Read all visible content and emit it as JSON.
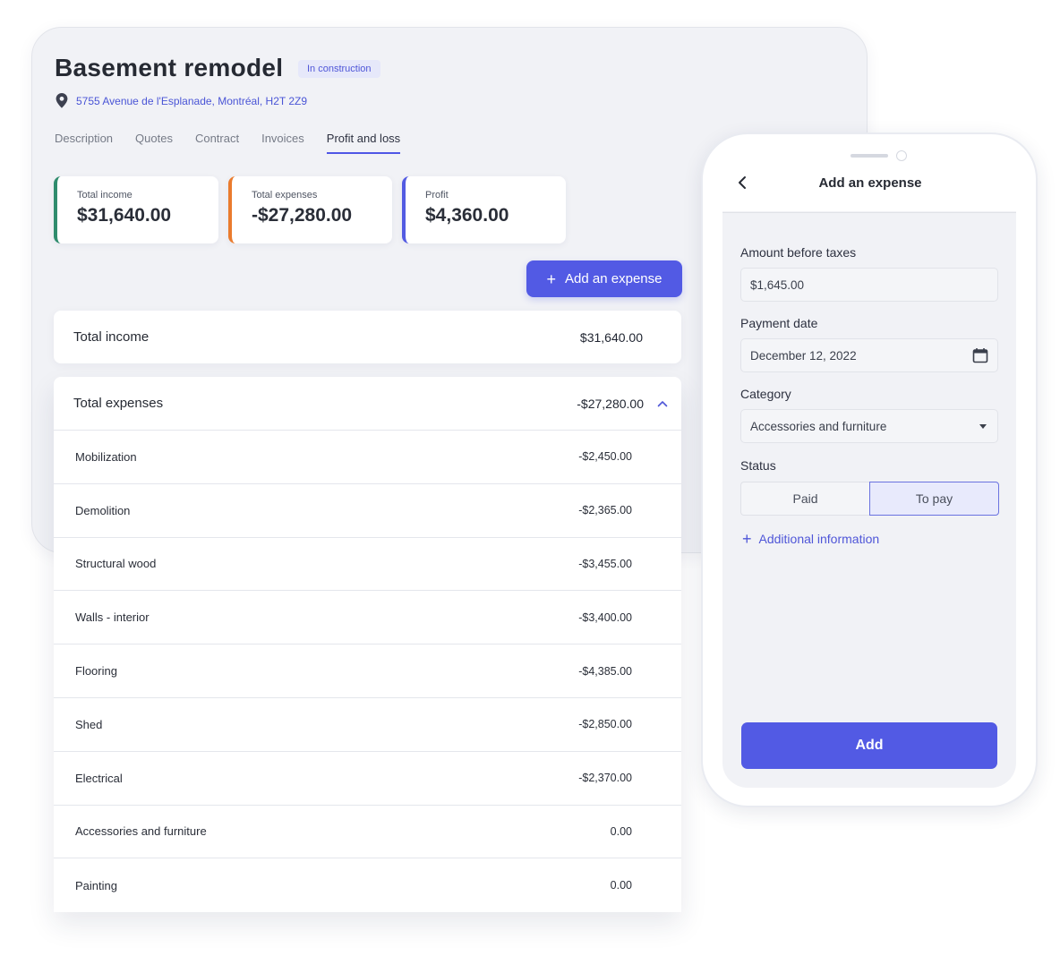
{
  "project": {
    "title": "Basement remodel",
    "status": "In construction",
    "address": "5755 Avenue de l'Esplanade, Montréal, H2T 2Z9"
  },
  "tabs": [
    "Description",
    "Quotes",
    "Contract",
    "Invoices",
    "Profit and loss"
  ],
  "summary": {
    "income_label": "Total income",
    "income_value": "$31,640.00",
    "expenses_label": "Total expenses",
    "expenses_value": "-$27,280.00",
    "profit_label": "Profit",
    "profit_value": "$4,360.00"
  },
  "add_expense_label": "Add an expense",
  "income_panel": {
    "label": "Total income",
    "value": "$31,640.00"
  },
  "expenses_panel": {
    "label": "Total expenses",
    "value": "-$27,280.00",
    "rows": [
      {
        "name": "Mobilization",
        "amount": "-$2,450.00"
      },
      {
        "name": "Demolition",
        "amount": "-$2,365.00"
      },
      {
        "name": "Structural wood",
        "amount": "-$3,455.00"
      },
      {
        "name": "Walls - interior",
        "amount": "-$3,400.00"
      },
      {
        "name": "Flooring",
        "amount": "-$4,385.00"
      },
      {
        "name": "Shed",
        "amount": "-$2,850.00"
      },
      {
        "name": "Electrical",
        "amount": "-$2,370.00"
      },
      {
        "name": "Accessories and furniture",
        "amount": "0.00"
      },
      {
        "name": "Painting",
        "amount": "0.00"
      }
    ]
  },
  "mobile": {
    "title": "Add an expense",
    "amount_label": "Amount before taxes",
    "amount_value": "$1,645.00",
    "date_label": "Payment date",
    "date_value": "December 12, 2022",
    "category_label": "Category",
    "category_value": "Accessories and furniture",
    "status_label": "Status",
    "status_options": [
      "Paid",
      "To pay"
    ],
    "status_selected": "To pay",
    "additional_info": "Additional information",
    "submit": "Add"
  },
  "colors": {
    "accent": "#525ae4",
    "income": "#2f8c6d",
    "expenses": "#ea7b2d",
    "profit": "#535be2"
  }
}
